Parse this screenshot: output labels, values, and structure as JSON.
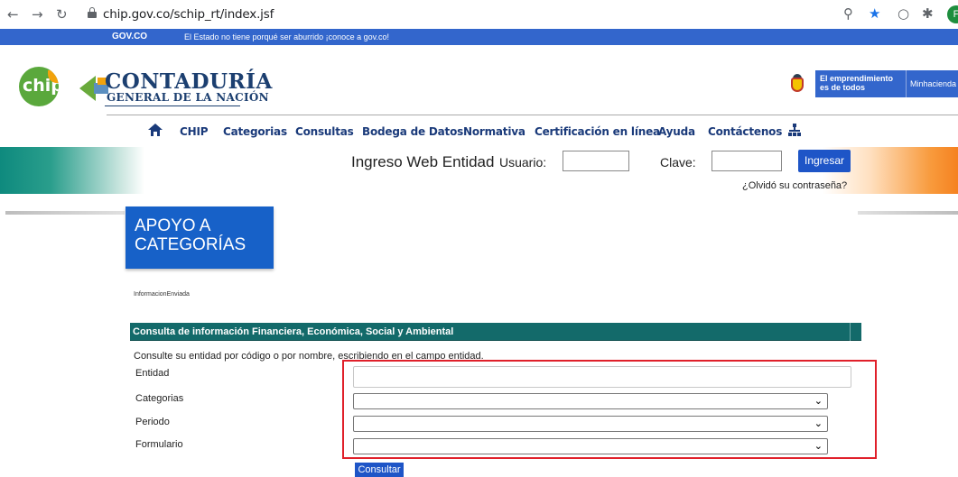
{
  "browser": {
    "url": "chip.gov.co/schip_rt/index.jsf",
    "profile_initial": "F"
  },
  "govbar": {
    "logo": "GOV.CO",
    "message": "El Estado no tiene porqué ser aburrido ¡conoce a gov.co!"
  },
  "header": {
    "chip_logo": "chip",
    "org_title": "CONTADURÍA",
    "org_subtitle": "GENERAL DE LA NACIÓN",
    "gov_slogan_line1": "El emprendimiento",
    "gov_slogan_line2": "es de todos",
    "ministry": "Minhacienda"
  },
  "nav": {
    "items": [
      {
        "label": "CHIP"
      },
      {
        "label": "Categorias"
      },
      {
        "label": "Consultas"
      },
      {
        "label": "Bodega de Datos"
      },
      {
        "label": "Normativa"
      },
      {
        "label": "Certificación en línea"
      },
      {
        "label": "Ayuda"
      },
      {
        "label": "Contáctenos"
      }
    ]
  },
  "login": {
    "title": "Ingreso Web Entidad",
    "usuario_label": "Usuario:",
    "usuario_value": "",
    "clave_label": "Clave:",
    "clave_value": "",
    "submit_label": "Ingresar",
    "forgot_label": "¿Olvidó su contraseña?"
  },
  "banner": {
    "line1": "APOYO A",
    "line2": "CATEGORÍAS"
  },
  "breadcrumb": "InformacionEnviada",
  "form": {
    "section_title": "Consulta de información Financiera, Económica, Social y Ambiental",
    "hint": "Consulte su entidad por código o por nombre, escribiendo en el campo entidad.",
    "entidad_label": "Entidad",
    "entidad_value": "",
    "categorias_label": "Categorias",
    "categorias_value": "",
    "periodo_label": "Periodo",
    "periodo_value": "",
    "formulario_label": "Formulario",
    "formulario_value": "",
    "submit_label": "Consultar"
  },
  "colors": {
    "nav_text": "#1a3a7a",
    "section_header": "#136a6a",
    "button_blue": "#1e55c7",
    "banner_blue": "#1761c8",
    "highlight_red": "#e0202a",
    "govbar_blue": "#3366cc"
  }
}
